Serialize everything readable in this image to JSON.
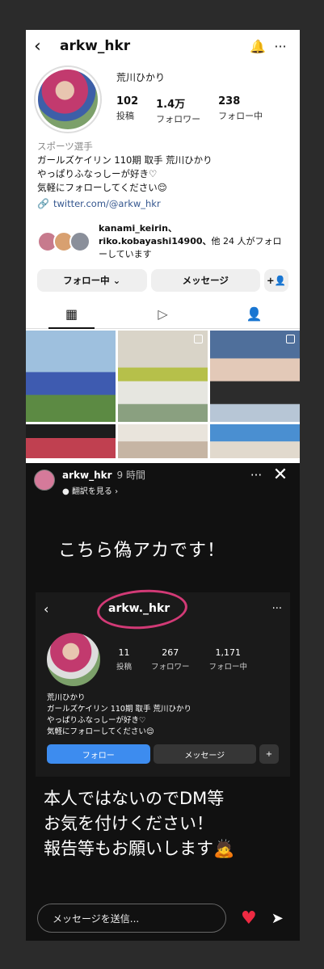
{
  "profile": {
    "username": "arkw_hkr",
    "real_name": "荒川ひかり",
    "stats": [
      {
        "value": "102",
        "label": "投稿"
      },
      {
        "value": "1.4万",
        "label": "フォロワー"
      },
      {
        "value": "238",
        "label": "フォロー中"
      }
    ],
    "category": "スポーツ選手",
    "bio_lines": [
      "ガールズケイリン 110期 取手 荒川ひかり",
      "やっぱりふなっしーが好き♡",
      "気軽にフォローしてください😌"
    ],
    "link": "twitter.com/@arkw_hkr",
    "followed_by": {
      "names": "kanami_keirin、riko.kobayashi14900、",
      "suffix": "他 24 人がフォローしています"
    },
    "buttons": {
      "following": "フォロー中 ⌄",
      "message": "メッセージ",
      "add_user": "+👤"
    },
    "tabs": [
      "▦",
      "▷",
      "👤"
    ]
  },
  "story": {
    "username": "arkw_hkr",
    "time": "9 時間",
    "translate": "● 翻訳を見る ›",
    "more": "···",
    "close": "✕",
    "warning_top": "こちら偽アカです！",
    "fake_profile": {
      "username": "arkw._hkr",
      "stats": [
        {
          "value": "11",
          "label": "投稿"
        },
        {
          "value": "267",
          "label": "フォロワー"
        },
        {
          "value": "1,171",
          "label": "フォロー中"
        }
      ],
      "name": "荒川ひかり",
      "bio_lines": [
        "ガールズケイリン 110期 取手 荒川ひかり",
        "やっぱりふなっしーが好き♡",
        "気軽にフォローしてください😌"
      ],
      "follow_button": "フォロー",
      "message_button": "メッセージ"
    },
    "warning_bottom": [
      "本人ではないのでDM等",
      "お気を付けください！",
      "報告等もお願いします🙇"
    ],
    "message_placeholder": "メッセージを送信..."
  }
}
